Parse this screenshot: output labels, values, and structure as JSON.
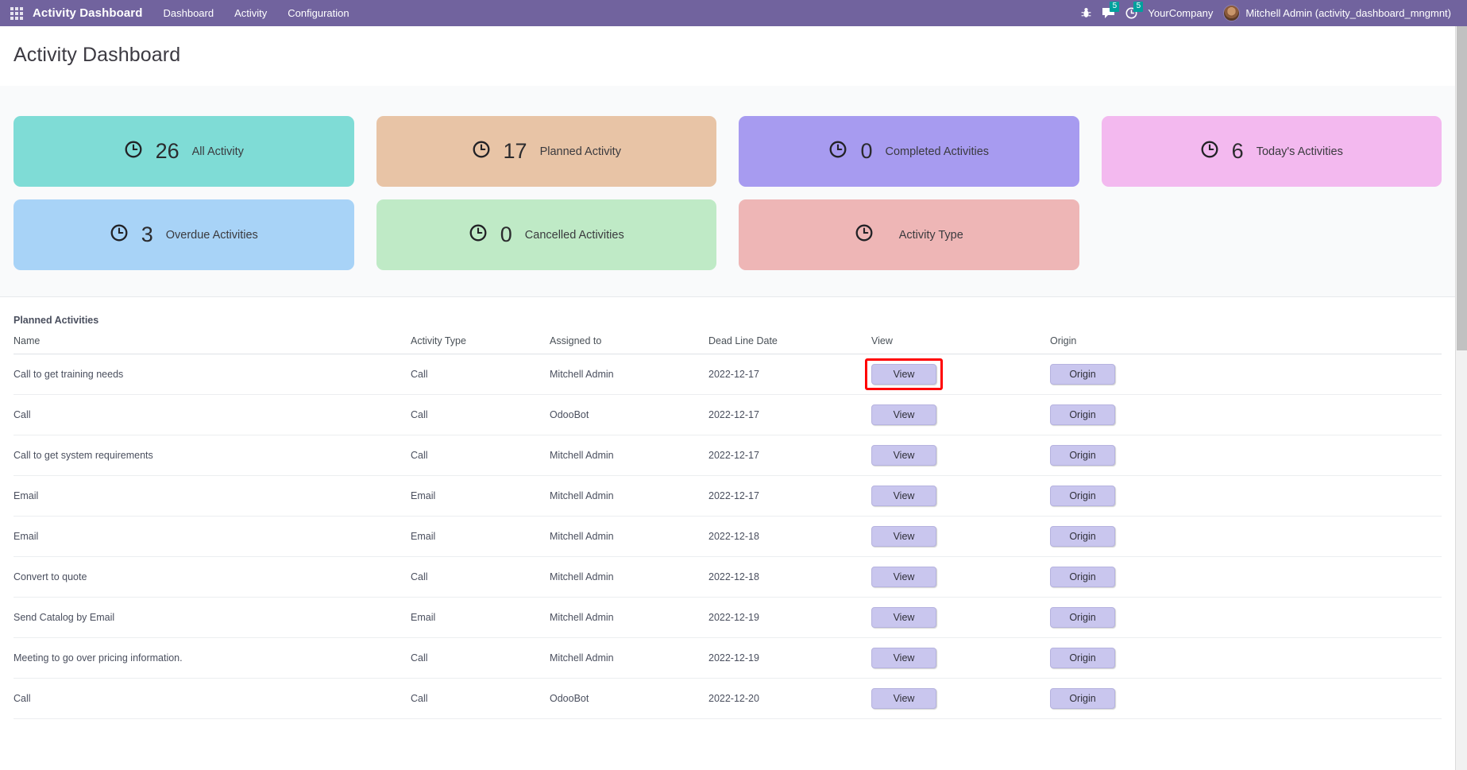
{
  "navbar": {
    "apps_icon": "apps-grid-icon",
    "brand": "Activity Dashboard",
    "menu": [
      {
        "label": "Dashboard"
      },
      {
        "label": "Activity"
      },
      {
        "label": "Configuration"
      }
    ],
    "debug_icon": "bug-icon",
    "messages_icon": "chat-bubble-icon",
    "messages_count": "5",
    "activities_icon": "clock-icon",
    "activities_count": "5",
    "company": "YourCompany",
    "avatar_icon": "user-avatar",
    "user": "Mitchell Admin (activity_dashboard_mngmnt)"
  },
  "page": {
    "title": "Activity Dashboard"
  },
  "kpi": {
    "row1": [
      {
        "icon": "clock-icon",
        "value": "26",
        "label": "All Activity",
        "color": "#7fdcd6"
      },
      {
        "icon": "clock-icon",
        "value": "17",
        "label": "Planned Activity",
        "color": "#e8c4a6"
      },
      {
        "icon": "clock-icon",
        "value": "0",
        "label": "Completed Activities",
        "color": "#a79bf0"
      },
      {
        "icon": "clock-icon",
        "value": "6",
        "label": "Today's Activities",
        "color": "#f3b9ef"
      }
    ],
    "row2": [
      {
        "icon": "clock-icon",
        "value": "3",
        "label": "Overdue Activities",
        "color": "#a8d3f7"
      },
      {
        "icon": "clock-icon",
        "value": "0",
        "label": "Cancelled Activities",
        "color": "#bfeac6"
      },
      {
        "icon": "clock-icon",
        "value": "",
        "label": "Activity Type",
        "color": "#eeb6b6"
      }
    ]
  },
  "table": {
    "title": "Planned Activities",
    "headers": [
      "Name",
      "Activity Type",
      "Assigned to",
      "Dead Line Date",
      "View",
      "Origin"
    ],
    "view_label": "View",
    "origin_label": "Origin",
    "highlighted_row_index": 0,
    "rows": [
      {
        "name": "Call to get training needs",
        "type": "Call",
        "assigned": "Mitchell Admin",
        "deadline": "2022-12-17"
      },
      {
        "name": "Call",
        "type": "Call",
        "assigned": "OdooBot",
        "deadline": "2022-12-17"
      },
      {
        "name": "Call to get system requirements",
        "type": "Call",
        "assigned": "Mitchell Admin",
        "deadline": "2022-12-17"
      },
      {
        "name": "Email",
        "type": "Email",
        "assigned": "Mitchell Admin",
        "deadline": "2022-12-17"
      },
      {
        "name": "Email",
        "type": "Email",
        "assigned": "Mitchell Admin",
        "deadline": "2022-12-18"
      },
      {
        "name": "Convert to quote",
        "type": "Call",
        "assigned": "Mitchell Admin",
        "deadline": "2022-12-18"
      },
      {
        "name": "Send Catalog by Email",
        "type": "Email",
        "assigned": "Mitchell Admin",
        "deadline": "2022-12-19"
      },
      {
        "name": "Meeting to go over pricing information.",
        "type": "Call",
        "assigned": "Mitchell Admin",
        "deadline": "2022-12-19"
      },
      {
        "name": "Call",
        "type": "Call",
        "assigned": "OdooBot",
        "deadline": "2022-12-20"
      }
    ]
  },
  "colors": {
    "navbar": "#71639e",
    "badge": "#00a09d",
    "button": "#c9c6ee",
    "highlight": "#ff0000"
  }
}
